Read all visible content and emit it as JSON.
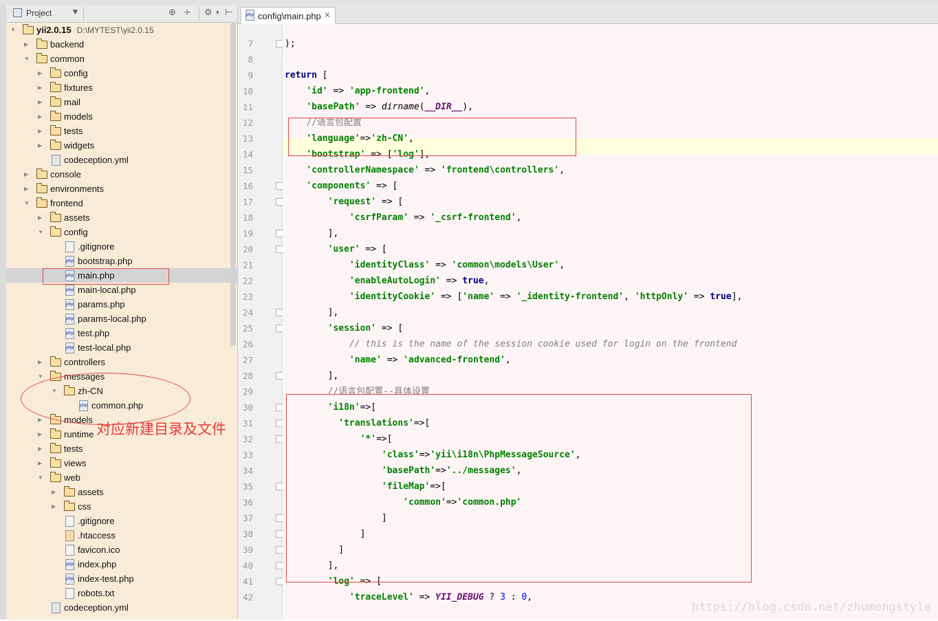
{
  "project_panel": {
    "title": "Project",
    "tree": [
      {
        "label": "yii2.0.15",
        "path": "D:\\MYTEST\\yii2.0.15",
        "kind": "folder",
        "depth": 0,
        "expanded": true,
        "bold": true
      },
      {
        "label": "backend",
        "kind": "folder",
        "depth": 1,
        "expanded": false
      },
      {
        "label": "common",
        "kind": "folder",
        "depth": 1,
        "expanded": true
      },
      {
        "label": "config",
        "kind": "folder",
        "depth": 2,
        "expanded": false
      },
      {
        "label": "fixtures",
        "kind": "folder",
        "depth": 2,
        "expanded": false
      },
      {
        "label": "mail",
        "kind": "folder",
        "depth": 2,
        "expanded": false
      },
      {
        "label": "models",
        "kind": "folder",
        "depth": 2,
        "expanded": false
      },
      {
        "label": "tests",
        "kind": "folder",
        "depth": 2,
        "expanded": false
      },
      {
        "label": "widgets",
        "kind": "folder",
        "depth": 2,
        "expanded": false
      },
      {
        "label": "codeception.yml",
        "kind": "yml",
        "depth": 2
      },
      {
        "label": "console",
        "kind": "folder",
        "depth": 1,
        "expanded": false
      },
      {
        "label": "environments",
        "kind": "folder",
        "depth": 1,
        "expanded": false
      },
      {
        "label": "frontend",
        "kind": "folder",
        "depth": 1,
        "expanded": true
      },
      {
        "label": "assets",
        "kind": "folder",
        "depth": 2,
        "expanded": false
      },
      {
        "label": "config",
        "kind": "folder",
        "depth": 2,
        "expanded": true
      },
      {
        "label": ".gitignore",
        "kind": "txt",
        "depth": 3
      },
      {
        "label": "bootstrap.php",
        "kind": "php",
        "depth": 3
      },
      {
        "label": "main.php",
        "kind": "php",
        "depth": 3,
        "selected": true
      },
      {
        "label": "main-local.php",
        "kind": "php",
        "depth": 3
      },
      {
        "label": "params.php",
        "kind": "php",
        "depth": 3
      },
      {
        "label": "params-local.php",
        "kind": "php",
        "depth": 3
      },
      {
        "label": "test.php",
        "kind": "php",
        "depth": 3
      },
      {
        "label": "test-local.php",
        "kind": "php",
        "depth": 3
      },
      {
        "label": "controllers",
        "kind": "folder",
        "depth": 2,
        "expanded": false
      },
      {
        "label": "messages",
        "kind": "folder",
        "depth": 2,
        "expanded": true
      },
      {
        "label": "zh-CN",
        "kind": "folder",
        "depth": 3,
        "expanded": true
      },
      {
        "label": "common.php",
        "kind": "php",
        "depth": 4
      },
      {
        "label": "models",
        "kind": "folder",
        "depth": 2,
        "expanded": false
      },
      {
        "label": "runtime",
        "kind": "folder",
        "depth": 2,
        "expanded": false
      },
      {
        "label": "tests",
        "kind": "folder",
        "depth": 2,
        "expanded": false
      },
      {
        "label": "views",
        "kind": "folder",
        "depth": 2,
        "expanded": false
      },
      {
        "label": "web",
        "kind": "folder",
        "depth": 2,
        "expanded": true
      },
      {
        "label": "assets",
        "kind": "folder",
        "depth": 3,
        "expanded": false
      },
      {
        "label": "css",
        "kind": "folder",
        "depth": 3,
        "expanded": false
      },
      {
        "label": ".gitignore",
        "kind": "txt",
        "depth": 3
      },
      {
        "label": ".htaccess",
        "kind": "ht",
        "depth": 3
      },
      {
        "label": "favicon.ico",
        "kind": "txt",
        "depth": 3
      },
      {
        "label": "index.php",
        "kind": "php",
        "depth": 3
      },
      {
        "label": "index-test.php",
        "kind": "php",
        "depth": 3
      },
      {
        "label": "robots.txt",
        "kind": "txt",
        "depth": 3
      },
      {
        "label": "codeception.yml",
        "kind": "yml",
        "depth": 2
      }
    ]
  },
  "editor": {
    "tab_label": "config\\main.php",
    "current_line": 13,
    "lines": [
      {
        "n": 7,
        "tokens": [
          {
            "t": ");",
            "c": ""
          }
        ]
      },
      {
        "n": 8,
        "tokens": []
      },
      {
        "n": 9,
        "tokens": [
          {
            "t": "return",
            "c": "k"
          },
          {
            "t": " [",
            "c": ""
          }
        ]
      },
      {
        "n": 10,
        "tokens": [
          {
            "t": "    ",
            "c": ""
          },
          {
            "t": "'id'",
            "c": "s"
          },
          {
            "t": " => ",
            "c": ""
          },
          {
            "t": "'app-frontend'",
            "c": "s"
          },
          {
            "t": ",",
            "c": ""
          }
        ]
      },
      {
        "n": 11,
        "tokens": [
          {
            "t": "    ",
            "c": ""
          },
          {
            "t": "'basePath'",
            "c": "s"
          },
          {
            "t": " => ",
            "c": ""
          },
          {
            "t": "dirname",
            "c": "f"
          },
          {
            "t": "(",
            "c": ""
          },
          {
            "t": "__DIR__",
            "c": "m"
          },
          {
            "t": "),",
            "c": ""
          }
        ]
      },
      {
        "n": 12,
        "tokens": [
          {
            "t": "    ",
            "c": ""
          },
          {
            "t": "//语言包配置",
            "c": "cz"
          }
        ]
      },
      {
        "n": 13,
        "tokens": [
          {
            "t": "    ",
            "c": ""
          },
          {
            "t": "'language'",
            "c": "s"
          },
          {
            "t": "=>",
            "c": ""
          },
          {
            "t": "'zh-CN'",
            "c": "s"
          },
          {
            "t": ",",
            "c": ""
          }
        ]
      },
      {
        "n": 14,
        "tokens": [
          {
            "t": "    ",
            "c": ""
          },
          {
            "t": "'bootstrap'",
            "c": "s"
          },
          {
            "t": " => [",
            "c": ""
          },
          {
            "t": "'log'",
            "c": "s"
          },
          {
            "t": "],",
            "c": ""
          }
        ]
      },
      {
        "n": 15,
        "tokens": [
          {
            "t": "    ",
            "c": ""
          },
          {
            "t": "'controllerNamespace'",
            "c": "s"
          },
          {
            "t": " => ",
            "c": ""
          },
          {
            "t": "'frontend\\controllers'",
            "c": "s"
          },
          {
            "t": ",",
            "c": ""
          }
        ]
      },
      {
        "n": 16,
        "tokens": [
          {
            "t": "    ",
            "c": ""
          },
          {
            "t": "'components'",
            "c": "s"
          },
          {
            "t": " => [",
            "c": ""
          }
        ]
      },
      {
        "n": 17,
        "tokens": [
          {
            "t": "        ",
            "c": ""
          },
          {
            "t": "'request'",
            "c": "s"
          },
          {
            "t": " => [",
            "c": ""
          }
        ]
      },
      {
        "n": 18,
        "tokens": [
          {
            "t": "            ",
            "c": ""
          },
          {
            "t": "'csrfParam'",
            "c": "s"
          },
          {
            "t": " => ",
            "c": ""
          },
          {
            "t": "'_csrf-frontend'",
            "c": "s"
          },
          {
            "t": ",",
            "c": ""
          }
        ]
      },
      {
        "n": 19,
        "tokens": [
          {
            "t": "        ],",
            "c": ""
          }
        ]
      },
      {
        "n": 20,
        "tokens": [
          {
            "t": "        ",
            "c": ""
          },
          {
            "t": "'user'",
            "c": "s"
          },
          {
            "t": " => [",
            "c": ""
          }
        ]
      },
      {
        "n": 21,
        "tokens": [
          {
            "t": "            ",
            "c": ""
          },
          {
            "t": "'identityClass'",
            "c": "s"
          },
          {
            "t": " => ",
            "c": ""
          },
          {
            "t": "'common\\models\\User'",
            "c": "s"
          },
          {
            "t": ",",
            "c": ""
          }
        ]
      },
      {
        "n": 22,
        "tokens": [
          {
            "t": "            ",
            "c": ""
          },
          {
            "t": "'enableAutoLogin'",
            "c": "s"
          },
          {
            "t": " => ",
            "c": ""
          },
          {
            "t": "true",
            "c": "k"
          },
          {
            "t": ",",
            "c": ""
          }
        ]
      },
      {
        "n": 23,
        "tokens": [
          {
            "t": "            ",
            "c": ""
          },
          {
            "t": "'identityCookie'",
            "c": "s"
          },
          {
            "t": " => [",
            "c": ""
          },
          {
            "t": "'name'",
            "c": "s"
          },
          {
            "t": " => ",
            "c": ""
          },
          {
            "t": "'_identity-frontend'",
            "c": "s"
          },
          {
            "t": ", ",
            "c": ""
          },
          {
            "t": "'httpOnly'",
            "c": "s"
          },
          {
            "t": " => ",
            "c": ""
          },
          {
            "t": "true",
            "c": "k"
          },
          {
            "t": "],",
            "c": ""
          }
        ]
      },
      {
        "n": 24,
        "tokens": [
          {
            "t": "        ],",
            "c": ""
          }
        ]
      },
      {
        "n": 25,
        "tokens": [
          {
            "t": "        ",
            "c": ""
          },
          {
            "t": "'session'",
            "c": "s"
          },
          {
            "t": " => [",
            "c": ""
          }
        ]
      },
      {
        "n": 26,
        "tokens": [
          {
            "t": "            ",
            "c": ""
          },
          {
            "t": "// this is the name of the session cookie used for login on the frontend",
            "c": "c"
          }
        ]
      },
      {
        "n": 27,
        "tokens": [
          {
            "t": "            ",
            "c": ""
          },
          {
            "t": "'name'",
            "c": "s"
          },
          {
            "t": " => ",
            "c": ""
          },
          {
            "t": "'advanced-frontend'",
            "c": "s"
          },
          {
            "t": ",",
            "c": ""
          }
        ]
      },
      {
        "n": 28,
        "tokens": [
          {
            "t": "        ],",
            "c": ""
          }
        ]
      },
      {
        "n": 29,
        "tokens": [
          {
            "t": "        ",
            "c": ""
          },
          {
            "t": "//语言包配置--具体设置",
            "c": "cz"
          }
        ]
      },
      {
        "n": 30,
        "tokens": [
          {
            "t": "        ",
            "c": ""
          },
          {
            "t": "'i18n'",
            "c": "s"
          },
          {
            "t": "=>[",
            "c": ""
          }
        ]
      },
      {
        "n": 31,
        "tokens": [
          {
            "t": "          ",
            "c": ""
          },
          {
            "t": "'translations'",
            "c": "s"
          },
          {
            "t": "=>[",
            "c": ""
          }
        ]
      },
      {
        "n": 32,
        "tokens": [
          {
            "t": "              ",
            "c": ""
          },
          {
            "t": "'*'",
            "c": "s"
          },
          {
            "t": "=>[",
            "c": ""
          }
        ]
      },
      {
        "n": 33,
        "tokens": [
          {
            "t": "                  ",
            "c": ""
          },
          {
            "t": "'class'",
            "c": "s"
          },
          {
            "t": "=>",
            "c": ""
          },
          {
            "t": "'yii\\i18n\\PhpMessageSource'",
            "c": "s"
          },
          {
            "t": ",",
            "c": ""
          }
        ]
      },
      {
        "n": 34,
        "tokens": [
          {
            "t": "                  ",
            "c": ""
          },
          {
            "t": "'basePath'",
            "c": "s"
          },
          {
            "t": "=>",
            "c": ""
          },
          {
            "t": "'../messages'",
            "c": "s"
          },
          {
            "t": ",",
            "c": ""
          }
        ]
      },
      {
        "n": 35,
        "tokens": [
          {
            "t": "                  ",
            "c": ""
          },
          {
            "t": "'fileMap'",
            "c": "s"
          },
          {
            "t": "=>[",
            "c": ""
          }
        ]
      },
      {
        "n": 36,
        "tokens": [
          {
            "t": "                      ",
            "c": ""
          },
          {
            "t": "'common'",
            "c": "s"
          },
          {
            "t": "=>",
            "c": ""
          },
          {
            "t": "'common.php'",
            "c": "s"
          }
        ]
      },
      {
        "n": 37,
        "tokens": [
          {
            "t": "                  ]",
            "c": ""
          }
        ]
      },
      {
        "n": 38,
        "tokens": [
          {
            "t": "              ]",
            "c": ""
          }
        ]
      },
      {
        "n": 39,
        "tokens": [
          {
            "t": "          ]",
            "c": ""
          }
        ]
      },
      {
        "n": 40,
        "tokens": [
          {
            "t": "        ],",
            "c": ""
          }
        ]
      },
      {
        "n": 41,
        "tokens": [
          {
            "t": "        ",
            "c": ""
          },
          {
            "t": "'log'",
            "c": "s"
          },
          {
            "t": " => [",
            "c": ""
          }
        ]
      },
      {
        "n": 42,
        "tokens": [
          {
            "t": "            ",
            "c": ""
          },
          {
            "t": "'traceLevel'",
            "c": "s"
          },
          {
            "t": " => ",
            "c": ""
          },
          {
            "t": "YII_DEBUG",
            "c": "m"
          },
          {
            "t": " ? ",
            "c": ""
          },
          {
            "t": "3",
            "c": "n"
          },
          {
            "t": " : ",
            "c": ""
          },
          {
            "t": "0",
            "c": "n"
          },
          {
            "t": ",",
            "c": ""
          }
        ]
      }
    ]
  },
  "annotation": {
    "note": "对应新建目录及文件",
    "color": "#e04848"
  },
  "watermark": "https://blog.csdn.net/zhumengstyle"
}
